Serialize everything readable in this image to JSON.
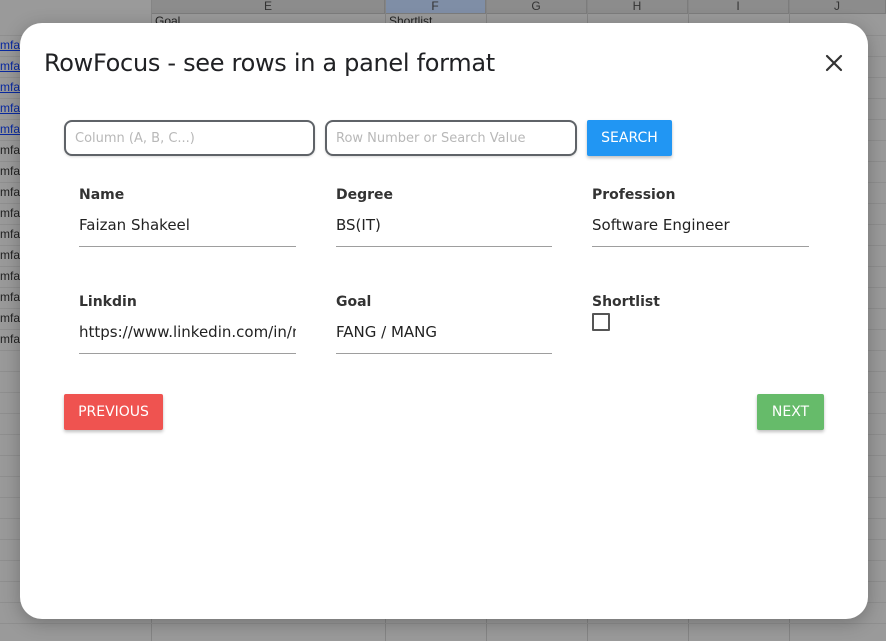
{
  "sheet": {
    "column_headers": [
      "E",
      "F",
      "G",
      "H",
      "I",
      "J"
    ],
    "row1_cells": [
      "Goal",
      "Shortlist"
    ],
    "left_cells": [
      "mfa",
      "mfa",
      "mfa",
      "mfa",
      "mfa",
      "mfa",
      "mfa",
      "mfa",
      "mfa",
      "mfa",
      "mfa",
      "mfa",
      "mfa",
      "mfa",
      "mfa"
    ]
  },
  "dialog": {
    "title": "RowFocus - see rows in a panel format",
    "column_placeholder": "Column (A, B, C...)",
    "row_placeholder": "Row Number or Search Value",
    "search_label": "SEARCH",
    "previous_label": "PREVIOUS",
    "next_label": "NEXT",
    "fields": [
      {
        "label": "Name",
        "value": "Faizan Shakeel"
      },
      {
        "label": "Degree",
        "value": "BS(IT)"
      },
      {
        "label": "Profession",
        "value": "Software Engineer"
      },
      {
        "label": "Linkdin",
        "value": "https://www.linkedin.com/in/m"
      },
      {
        "label": "Goal",
        "value": "FANG / MANG"
      },
      {
        "label": "Shortlist",
        "checked": false
      }
    ]
  },
  "colors": {
    "search": "#2196f3",
    "previous": "#ef5350",
    "next": "#66bb6a"
  }
}
